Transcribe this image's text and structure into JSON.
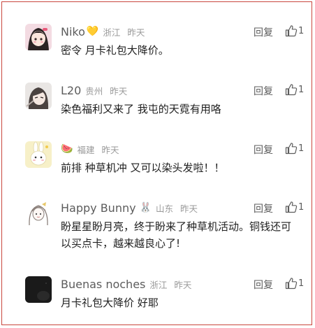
{
  "comments": [
    {
      "username": "Niko",
      "badge": "💛",
      "location": "浙江",
      "time": "昨天",
      "reply_label": "回复",
      "likes": "1",
      "text": "密令 月卡礼包大降价。",
      "avatar": "anime-girl-avatar"
    },
    {
      "username": "L20",
      "badge": "",
      "location": "贵州",
      "time": "昨天",
      "reply_label": "回复",
      "likes": "1",
      "text": "染色福利又来了 我屯的天霓有用咯",
      "avatar": "anime-boy-avatar"
    },
    {
      "username": "",
      "badge": "🍉",
      "location": "福建",
      "time": "昨天",
      "reply_label": "回复",
      "likes": "1",
      "text": "前排 种草机冲 又可以染头发啦！！",
      "avatar": "bunny-avatar"
    },
    {
      "username": "Happy Bunny",
      "badge": "🐰",
      "location": "山东",
      "time": "昨天",
      "reply_label": "回复",
      "likes": "1",
      "text": "盼星星盼月亮，终于盼来了种草机活动。铜钱还可以买点卡，越来越良心了!",
      "avatar": "sketch-girl-avatar"
    },
    {
      "username": "Buenas noches",
      "badge": "",
      "location": "浙江",
      "time": "昨天",
      "reply_label": "回复",
      "likes": "1",
      "text": "月卡礼包大降价 好耶",
      "avatar": "dark-avatar"
    }
  ],
  "colors": {
    "frame_border": "#c9463d",
    "name": "#5c5c5c",
    "meta": "#9a9a9a",
    "text": "#1f1f1f"
  },
  "icons": {
    "like": "thumbs-up-icon"
  }
}
